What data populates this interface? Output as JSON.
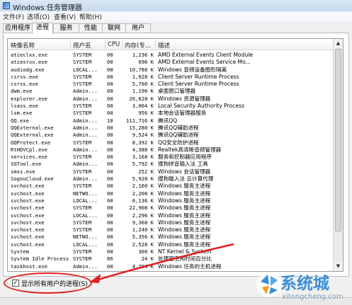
{
  "window": {
    "title": "Windows 任务管理器"
  },
  "menu": [
    "文件(F)",
    "选项(O)",
    "查看(V)",
    "帮助(H)"
  ],
  "tabs": [
    "应用程序",
    "进程",
    "服务",
    "性能",
    "联网",
    "用户"
  ],
  "active_tab": "进程",
  "columns": [
    "映像名称",
    "用户名",
    "CPU",
    "内存(专...",
    "描述"
  ],
  "rows": [
    [
      "atieclxx.exe",
      "SYSTEM",
      "00",
      "1,236 K",
      "AMD External Events Client Module"
    ],
    [
      "atiesrxx.exe",
      "SYSTEM",
      "00",
      "696 K",
      "AMD External Events Service Mo..."
    ],
    [
      "audiodg.exe",
      "LOCAL...",
      "00",
      "10,788 K",
      "Windows 音频设备图形隔离"
    ],
    [
      "csrss.exe",
      "SYSTEM",
      "00",
      "1,028 K",
      "Client Server Runtime Process"
    ],
    [
      "csrss.exe",
      "SYSTEM",
      "00",
      "5,760 K",
      "Client Server Runtime Process"
    ],
    [
      "dwm.exe",
      "Admin...",
      "00",
      "1,196 K",
      "桌面窗口管理器"
    ],
    [
      "explorer.exe",
      "Admin...",
      "00",
      "26,628 K",
      "Windows 资源管理器"
    ],
    [
      "lsass.exe",
      "SYSTEM",
      "00",
      "3,004 K",
      "Local Security Authority Process"
    ],
    [
      "lsm.exe",
      "SYSTEM",
      "00",
      "956 K",
      "本地会话管理器服务"
    ],
    [
      "QQ.exe",
      "Admin...",
      "10",
      "111,716 K",
      "腾讯QQ"
    ],
    [
      "QQExternal.exe",
      "Admin...",
      "00",
      "15,280 K",
      "腾讯QQ辅助进程"
    ],
    [
      "QQExternal.exe",
      "Admin...",
      "00",
      "9,524 K",
      "腾讯QQ辅助进程"
    ],
    [
      "QQProtect.exe",
      "SYSTEM",
      "00",
      "8,392 K",
      "QQ安全防护进程"
    ],
    [
      "RtHDVCpl.exe",
      "Admin...",
      "00",
      "4,388 K",
      "Realtek高清晰音频管理器"
    ],
    [
      "services.exe",
      "SYSTEM",
      "00",
      "3,168 K",
      "服务和控制器应用程序"
    ],
    [
      "SGTool.exe",
      "Admin...",
      "00",
      "5,792 K",
      "搜狗拼音输入法 工具"
    ],
    [
      "smss.exe",
      "SYSTEM",
      "00",
      "252 K",
      "Windows 会话管理器"
    ],
    [
      "SogouCloud.exe",
      "Admin...",
      "00",
      "5,928 K",
      "搜狗输入法 云计算代理"
    ],
    [
      "svchost.exe",
      "SYSTEM",
      "00",
      "2,160 K",
      "Windows 服务主进程"
    ],
    [
      "svchost.exe",
      "NETWO...",
      "00",
      "2,208 K",
      "Windows 服务主进程"
    ],
    [
      "svchost.exe",
      "LOCAL...",
      "00",
      "6,136 K",
      "Windows 服务主进程"
    ],
    [
      "svchost.exe",
      "SYSTEM",
      "00",
      "22,908 K",
      "Windows 服务主进程"
    ],
    [
      "svchost.exe",
      "LOCAL...",
      "00",
      "2,296 K",
      "Windows 服务主进程"
    ],
    [
      "svchost.exe",
      "SYSTEM",
      "00",
      "9,368 K",
      "Windows 服务主进程"
    ],
    [
      "svchost.exe",
      "SYSTEM",
      "00",
      "1,240 K",
      "Windows 服务主进程"
    ],
    [
      "svchost.exe",
      "NETWO...",
      "00",
      "5,356 K",
      "Windows 服务主进程"
    ],
    [
      "svchost.exe",
      "LOCAL...",
      "00",
      "2,528 K",
      "Windows 服务主进程"
    ],
    [
      "System",
      "SYSTEM",
      "00",
      "300 K",
      "NT Kernel & System"
    ],
    [
      "System Idle Process",
      "SYSTEM",
      "86",
      "24 K",
      "处理器空闲时间百分比"
    ],
    [
      "taskhost.exe",
      "Admin...",
      "00",
      "4,704 K",
      "Windows 任务的主机进程"
    ]
  ],
  "show_all_users": {
    "label": "显示所有用户的进程(S)",
    "checked": "✓"
  },
  "watermark": {
    "text": "系统城",
    "url": "xitongcheng.com"
  },
  "colors": {
    "annotation": "#e02020",
    "watermark": "#3a8fd6"
  },
  "icons": {
    "app": "task-manager-icon",
    "scroll_up": "▲",
    "scroll_down": "▼"
  }
}
